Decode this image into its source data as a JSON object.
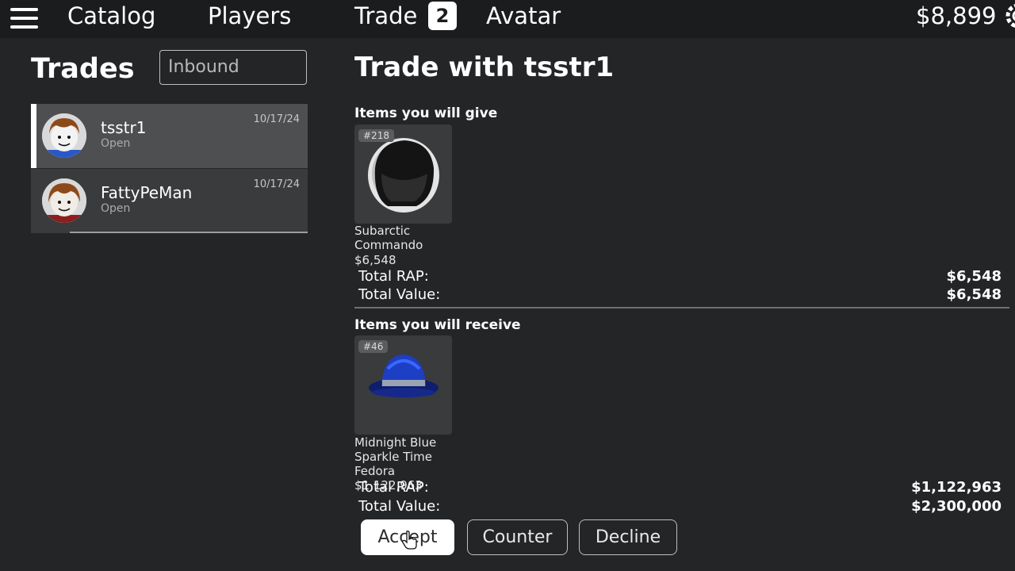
{
  "nav": {
    "items": [
      "Catalog",
      "Players",
      "Trade",
      "Avatar"
    ],
    "trade_badge": "2",
    "balance": "$8,899"
  },
  "sidebar": {
    "title": "Trades",
    "filter_value": "Inbound",
    "trades": [
      {
        "name": "tsstr1",
        "status": "Open",
        "date": "10/17/24"
      },
      {
        "name": "FattyPeMan",
        "status": "Open",
        "date": "10/17/24"
      }
    ]
  },
  "trade": {
    "title": "Trade with tsstr1",
    "give": {
      "heading": "Items you will give",
      "items": [
        {
          "serial": "#218",
          "name": "Subarctic Commando",
          "price": "$6,548"
        }
      ],
      "total_rap_label": "Total RAP:",
      "total_rap": "$6,548",
      "total_value_label": "Total Value:",
      "total_value": "$6,548"
    },
    "receive": {
      "heading": "Items you will receive",
      "items": [
        {
          "serial": "#46",
          "name": "Midnight Blue Sparkle Time Fedora",
          "price": "$1,122,963"
        }
      ],
      "total_rap_label": "Total RAP:",
      "total_rap": "$1,122,963",
      "total_value_label": "Total Value:",
      "total_value": "$2,300,000"
    },
    "actions": {
      "accept": "Accept",
      "counter": "Counter",
      "decline": "Decline"
    }
  },
  "colors": {
    "background": "#232527",
    "topbar": "#1b1c1e",
    "card": "#393b3d",
    "selected_row": "#4d4f51",
    "fedora_blue": "#1c3fc4"
  },
  "icons": [
    "menu-icon",
    "gear-icon",
    "cursor-icon"
  ]
}
